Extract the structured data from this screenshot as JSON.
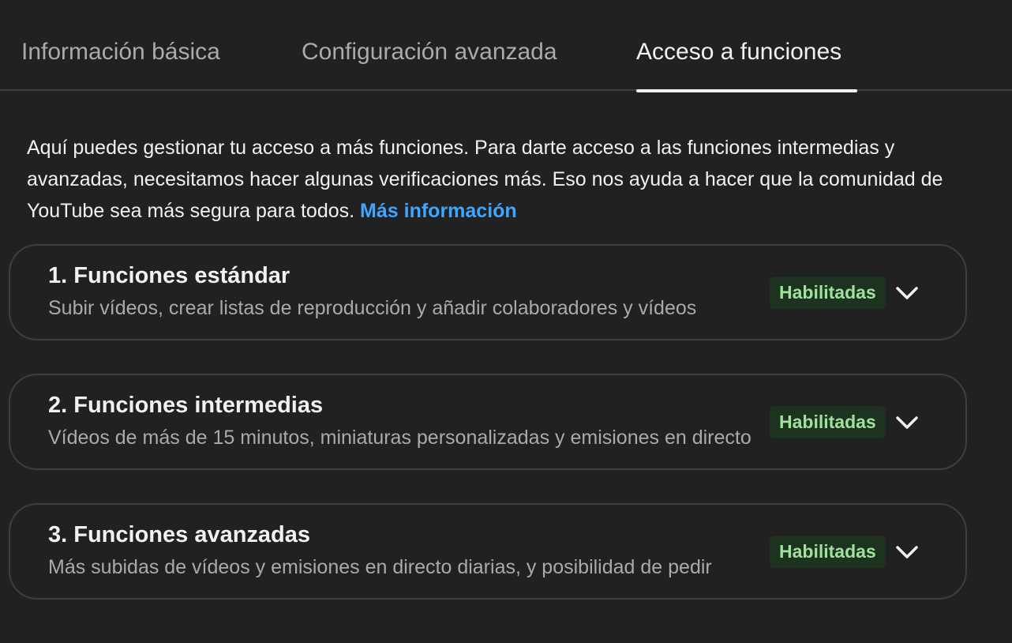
{
  "tabs": [
    {
      "label": "Información básica",
      "active": false
    },
    {
      "label": "Configuración avanzada",
      "active": false
    },
    {
      "label": "Acceso a funciones",
      "active": true
    }
  ],
  "intro": {
    "text": "Aquí puedes gestionar tu acceso a más funciones. Para darte acceso a las funciones intermedias y avanzadas, necesitamos hacer algunas verificaciones más. Eso nos ayuda a hacer que la comunidad de YouTube sea más segura para todos. ",
    "link_label": "Más información"
  },
  "features": [
    {
      "title": "1. Funciones estándar",
      "description": "Subir vídeos, crear listas de reproducción y añadir colaboradores y vídeos",
      "status": "Habilitadas",
      "icon": "chevron-down-icon"
    },
    {
      "title": "2. Funciones intermedias",
      "description": "Vídeos de más de 15 minutos, miniaturas personalizadas y emisiones en directo",
      "status": "Habilitadas",
      "icon": "chevron-down-icon"
    },
    {
      "title": "3. Funciones avanzadas",
      "description": "Más subidas de vídeos y emisiones en directo diarias, y posibilidad de pedir",
      "status": "Habilitadas",
      "icon": "chevron-down-icon"
    }
  ],
  "colors": {
    "background": "#212121",
    "link": "#3ea6ff",
    "badge_text": "#9fe29b",
    "badge_bg": "#1e3220"
  }
}
